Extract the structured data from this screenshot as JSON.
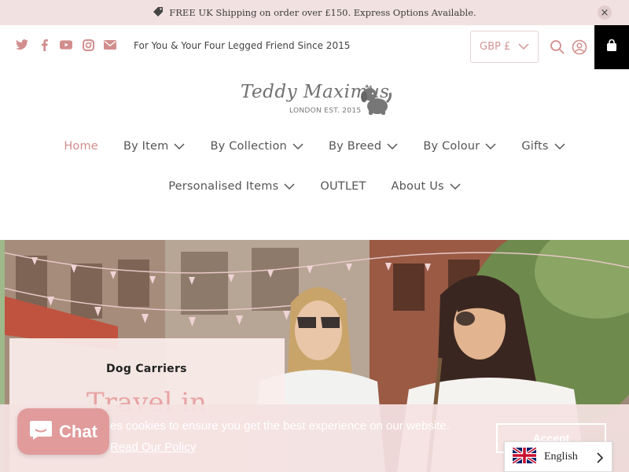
{
  "announcement": {
    "text": "FREE UK Shipping on order over £150. Express Options Available.",
    "icon": "tag-icon",
    "close_icon": "close-icon"
  },
  "header": {
    "socials": [
      "twitter-icon",
      "facebook-icon",
      "youtube-icon",
      "instagram-icon",
      "email-icon"
    ],
    "tagline": "For You & Your Four Legged Friend Since 2015",
    "currency": "GBP £",
    "icons": [
      "search-icon",
      "account-icon",
      "cart-icon"
    ]
  },
  "logo": {
    "name": "Teddy Maximus",
    "sub": "LONDON EST. 2015"
  },
  "nav": {
    "row1": [
      {
        "label": "Home",
        "active": true,
        "dropdown": false
      },
      {
        "label": "By Item",
        "dropdown": true
      },
      {
        "label": "By Collection",
        "dropdown": true
      },
      {
        "label": "By Breed",
        "dropdown": true
      },
      {
        "label": "By Colour",
        "dropdown": true
      },
      {
        "label": "Gifts",
        "dropdown": true
      }
    ],
    "row2": [
      {
        "label": "Personalised Items",
        "dropdown": true
      },
      {
        "label": "OUTLET",
        "dropdown": false
      },
      {
        "label": "About Us",
        "dropdown": true
      }
    ]
  },
  "hero": {
    "eyebrow": "Dog Carriers",
    "title": "Travel in"
  },
  "cookie": {
    "text": "es cookies to ensure you get the best experience on our website.",
    "link": "Read Our Policy",
    "accept": "Accept"
  },
  "chat": {
    "label": "Chat"
  },
  "language": {
    "label": "English"
  },
  "colors": {
    "announce_bg": "#f2e1e1",
    "accent_pink": "#d28d8d",
    "chat_pink": "#e19b9b",
    "cart_bg": "#000000"
  }
}
